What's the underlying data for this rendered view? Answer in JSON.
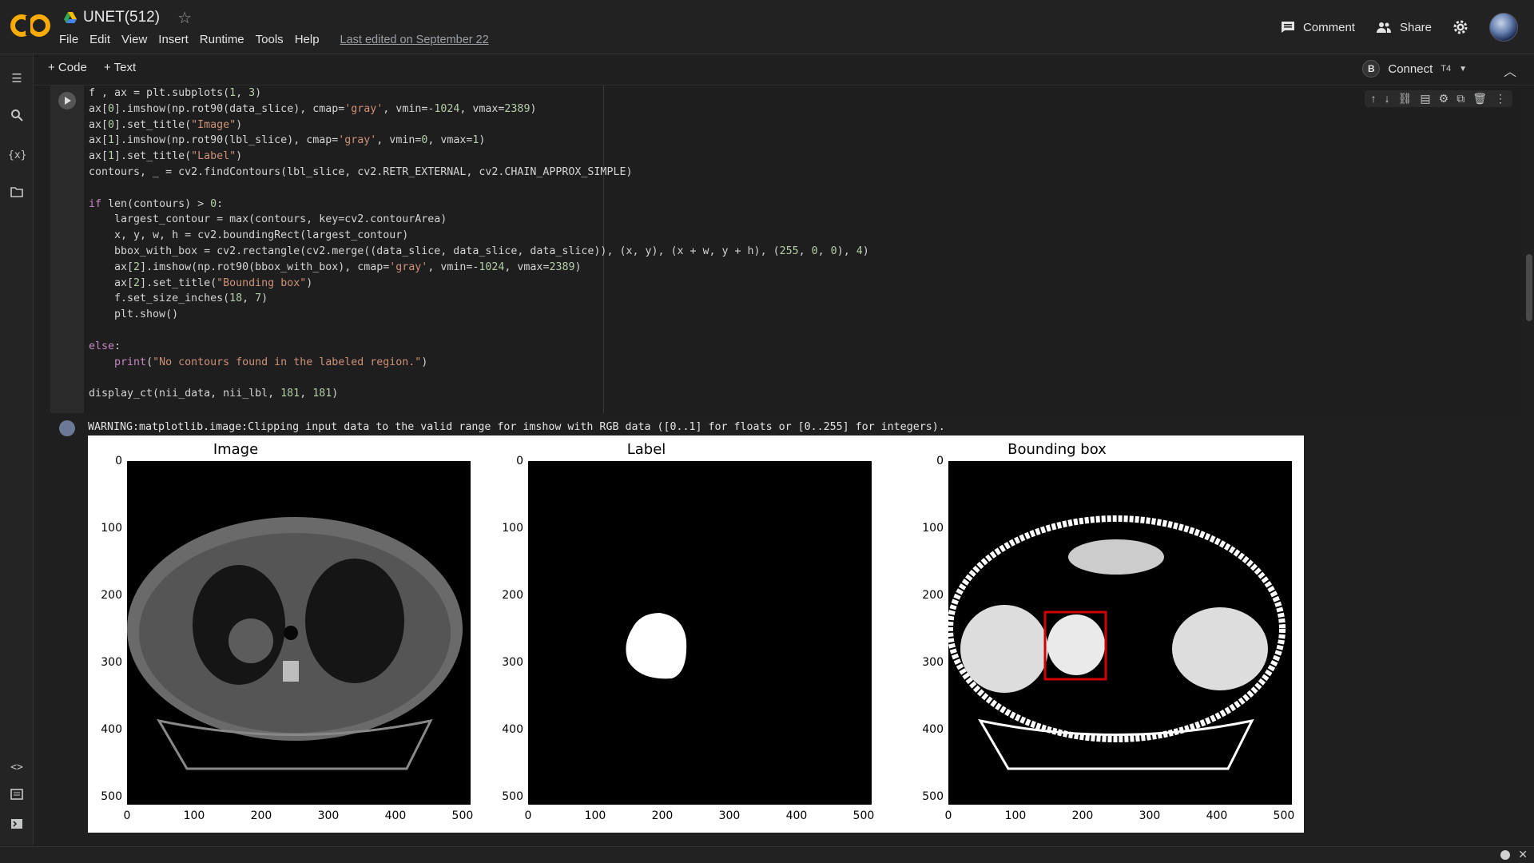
{
  "app": {
    "logo_text": "CO",
    "notebook_title": "UNET(512)"
  },
  "menu": [
    "File",
    "Edit",
    "View",
    "Insert",
    "Runtime",
    "Tools",
    "Help"
  ],
  "last_edited": "Last edited on September 22",
  "header_actions": {
    "comment": "Comment",
    "share": "Share"
  },
  "toolbar": {
    "add_code": "+ Code",
    "add_text": "+ Text",
    "badge": "B",
    "connect": "Connect",
    "runtime_type": "T4"
  },
  "code_lines": [
    "f , ax = plt.subplots(1, 3)",
    "ax[0].imshow(np.rot90(data_slice), cmap='gray', vmin=-1024, vmax=2389)",
    "ax[0].set_title(\"Image\")",
    "ax[1].imshow(np.rot90(lbl_slice), cmap='gray', vmin=0, vmax=1)",
    "ax[1].set_title(\"Label\")",
    "contours, _ = cv2.findContours(lbl_slice, cv2.RETR_EXTERNAL, cv2.CHAIN_APPROX_SIMPLE)",
    "",
    "if len(contours) > 0:",
    "    largest_contour = max(contours, key=cv2.contourArea)",
    "    x, y, w, h = cv2.boundingRect(largest_contour)",
    "    bbox_with_box = cv2.rectangle(cv2.merge((data_slice, data_slice, data_slice)), (x, y), (x + w, y + h), (255, 0, 0), 4)",
    "    ax[2].imshow(np.rot90(bbox_with_box), cmap='gray', vmin=-1024, vmax=2389)",
    "    ax[2].set_title(\"Bounding box\")",
    "    f.set_size_inches(18, 7)",
    "    plt.show()",
    "",
    "else:",
    "    print(\"No contours found in the labeled region.\")",
    "",
    "display_ct(nii_data, nii_lbl, 181, 181)"
  ],
  "warning": "WARNING:matplotlib.image:Clipping input data to the valid range for imshow with RGB data ([0..1] for floats or [0..255] for integers).",
  "subplots": [
    {
      "title": "Image"
    },
    {
      "title": "Label"
    },
    {
      "title": "Bounding box"
    }
  ],
  "axis_ticks": {
    "y": [
      "0",
      "100",
      "200",
      "300",
      "400",
      "500"
    ],
    "x": [
      "0",
      "100",
      "200",
      "300",
      "400",
      "500"
    ]
  },
  "bbox": {
    "color": "#d00000"
  },
  "colors": {
    "bg": "#1f1f1f",
    "accent": "#f9ab00"
  }
}
